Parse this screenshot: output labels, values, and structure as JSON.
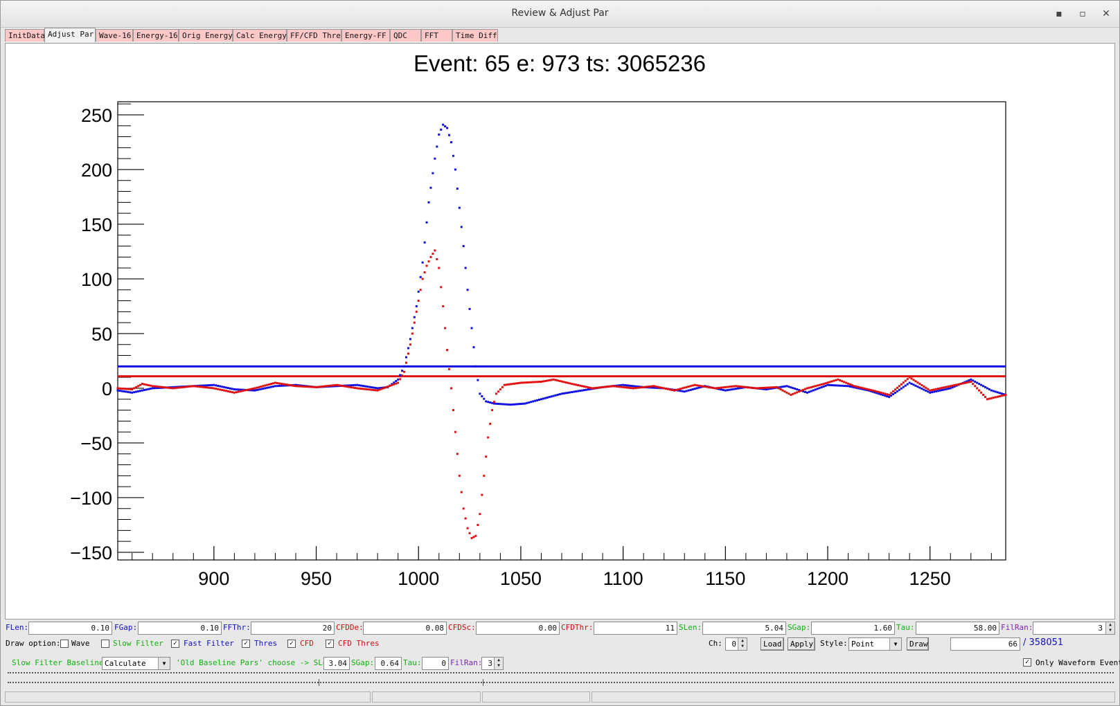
{
  "window": {
    "title": "Review & Adjust Par"
  },
  "tabs": [
    {
      "label": "InitData"
    },
    {
      "label": "Adjust Par"
    },
    {
      "label": "Wave-16"
    },
    {
      "label": "Energy-16"
    },
    {
      "label": "Orig Energy"
    },
    {
      "label": "Calc Energy"
    },
    {
      "label": "FF/CFD Thre"
    },
    {
      "label": "Energy-FF"
    },
    {
      "label": "QDC"
    },
    {
      "label": "FFT"
    },
    {
      "label": "Time Diff"
    }
  ],
  "chart_data": {
    "type": "scatter",
    "title": "Event: 65    e: 973    ts: 3065236",
    "xlabel": "",
    "ylabel": "",
    "xlim": [
      853,
      1287
    ],
    "ylim": [
      -157,
      262
    ],
    "x_ticks": [
      900,
      950,
      1000,
      1050,
      1100,
      1150,
      1200,
      1250
    ],
    "y_ticks": [
      -150,
      -100,
      -50,
      0,
      50,
      100,
      150,
      200,
      250
    ],
    "grid": false,
    "threshold_lines": [
      {
        "value": 20,
        "color": "#1010e0"
      },
      {
        "value": 11,
        "color": "#e01010"
      }
    ],
    "series": [
      {
        "color": "#1010e0",
        "points": [
          [
            853,
            -2
          ],
          [
            860,
            -4
          ],
          [
            870,
            0
          ],
          [
            880,
            1
          ],
          [
            890,
            2
          ],
          [
            900,
            3
          ],
          [
            910,
            -1
          ],
          [
            920,
            -2
          ],
          [
            930,
            2
          ],
          [
            940,
            3
          ],
          [
            950,
            1
          ],
          [
            960,
            2
          ],
          [
            970,
            3
          ],
          [
            980,
            0
          ],
          [
            985,
            1
          ],
          [
            990,
            8
          ],
          [
            993,
            20
          ],
          [
            996,
            45
          ],
          [
            999,
            75
          ],
          [
            1002,
            115
          ],
          [
            1005,
            170
          ],
          [
            1008,
            210
          ],
          [
            1010,
            232
          ],
          [
            1012,
            241
          ],
          [
            1014,
            238
          ],
          [
            1016,
            225
          ],
          [
            1018,
            200
          ],
          [
            1020,
            165
          ],
          [
            1022,
            130
          ],
          [
            1024,
            90
          ],
          [
            1026,
            55
          ],
          [
            1028,
            20
          ],
          [
            1030,
            -5
          ],
          [
            1033,
            -12
          ],
          [
            1037,
            -14
          ],
          [
            1045,
            -15
          ],
          [
            1052,
            -14
          ],
          [
            1060,
            -10
          ],
          [
            1070,
            -5
          ],
          [
            1080,
            -2
          ],
          [
            1090,
            1
          ],
          [
            1100,
            3
          ],
          [
            1110,
            1
          ],
          [
            1120,
            0
          ],
          [
            1130,
            -3
          ],
          [
            1140,
            2
          ],
          [
            1150,
            -2
          ],
          [
            1160,
            1
          ],
          [
            1170,
            -1
          ],
          [
            1180,
            2
          ],
          [
            1190,
            -4
          ],
          [
            1200,
            3
          ],
          [
            1210,
            2
          ],
          [
            1220,
            -2
          ],
          [
            1230,
            -8
          ],
          [
            1240,
            5
          ],
          [
            1250,
            -4
          ],
          [
            1260,
            0
          ],
          [
            1270,
            8
          ],
          [
            1280,
            -2
          ],
          [
            1287,
            -6
          ]
        ]
      },
      {
        "color": "#e01010",
        "points": [
          [
            853,
            0
          ],
          [
            860,
            -1
          ],
          [
            865,
            4
          ],
          [
            870,
            2
          ],
          [
            880,
            0
          ],
          [
            890,
            2
          ],
          [
            900,
            0
          ],
          [
            910,
            -4
          ],
          [
            920,
            0
          ],
          [
            930,
            5
          ],
          [
            940,
            2
          ],
          [
            950,
            1
          ],
          [
            960,
            3
          ],
          [
            970,
            0
          ],
          [
            980,
            -2
          ],
          [
            990,
            5
          ],
          [
            993,
            15
          ],
          [
            996,
            40
          ],
          [
            999,
            70
          ],
          [
            1002,
            100
          ],
          [
            1004,
            112
          ],
          [
            1006,
            120
          ],
          [
            1008,
            126
          ],
          [
            1010,
            110
          ],
          [
            1012,
            75
          ],
          [
            1014,
            35
          ],
          [
            1016,
            0
          ],
          [
            1018,
            -40
          ],
          [
            1020,
            -80
          ],
          [
            1022,
            -110
          ],
          [
            1024,
            -128
          ],
          [
            1026,
            -137
          ],
          [
            1028,
            -135
          ],
          [
            1030,
            -115
          ],
          [
            1032,
            -80
          ],
          [
            1034,
            -45
          ],
          [
            1036,
            -20
          ],
          [
            1038,
            -5
          ],
          [
            1042,
            3
          ],
          [
            1050,
            5
          ],
          [
            1060,
            6
          ],
          [
            1066,
            8
          ],
          [
            1075,
            4
          ],
          [
            1085,
            0
          ],
          [
            1095,
            2
          ],
          [
            1105,
            0
          ],
          [
            1115,
            2
          ],
          [
            1125,
            -2
          ],
          [
            1135,
            3
          ],
          [
            1145,
            0
          ],
          [
            1155,
            2
          ],
          [
            1165,
            0
          ],
          [
            1175,
            1
          ],
          [
            1182,
            -6
          ],
          [
            1190,
            0
          ],
          [
            1198,
            4
          ],
          [
            1205,
            8
          ],
          [
            1213,
            2
          ],
          [
            1222,
            -2
          ],
          [
            1230,
            -6
          ],
          [
            1240,
            10
          ],
          [
            1250,
            -2
          ],
          [
            1260,
            2
          ],
          [
            1270,
            6
          ],
          [
            1278,
            -10
          ],
          [
            1287,
            -6
          ]
        ]
      }
    ]
  },
  "params": {
    "flen": {
      "label": "FLen:",
      "value": "0.10",
      "color": "#1010c0"
    },
    "fgap": {
      "label": "FGap:",
      "value": "0.10",
      "color": "#1010c0"
    },
    "ffthr": {
      "label": "FFThr:",
      "value": "20",
      "color": "#1010c0"
    },
    "cfdde": {
      "label": "CFDDe:",
      "value": "0.08",
      "color": "#d01010"
    },
    "cfdsc": {
      "label": "CFDSc:",
      "value": "0.00",
      "color": "#d01010"
    },
    "cfdthr": {
      "label": "CFDThr:",
      "value": "11",
      "color": "#d01010"
    },
    "slen": {
      "label": "SLen:",
      "value": "5.04",
      "color": "#10b010"
    },
    "sgap": {
      "label": "SGap:",
      "value": "1.60",
      "color": "#10b010"
    },
    "tau": {
      "label": "Tau:",
      "value": "58.00",
      "color": "#10b010"
    },
    "filran": {
      "label": "FilRan:",
      "value": "3",
      "color": "#8020c0"
    }
  },
  "draw_options": {
    "label": "Draw option:",
    "wave": {
      "label": "Wave",
      "checked": false
    },
    "slow_filter": {
      "label": "Slow Filter",
      "checked": false
    },
    "fast_filter": {
      "label": "Fast Filter",
      "checked": true
    },
    "thres": {
      "label": "Thres",
      "checked": true
    },
    "cfd": {
      "label": "CFD",
      "checked": true
    },
    "cfd_thres": {
      "label": "CFD Thres",
      "checked": true
    },
    "ch_label": "Ch:",
    "ch_value": "0",
    "load": "Load",
    "apply": "Apply",
    "style_label": "Style:",
    "style_value": "Point",
    "draw": "Draw",
    "event_value": "66",
    "event_total": "/ 358051"
  },
  "baseline": {
    "label": "Slow Filter Baseline:",
    "mode": "Calculate",
    "old_label": "'Old Baseline Pars' choose -> SLen:",
    "slen": "3.04",
    "sgap_label": "SGap:",
    "sgap": "0.64",
    "tau_label": "Tau:",
    "tau": "0",
    "filran_label": "FilRan:",
    "filran": "3",
    "only_wave": {
      "label": "Only Waveform Event",
      "checked": true
    }
  },
  "glyphs": {
    "check": "✓",
    "minimize": "▪",
    "maximize": "▫",
    "close": "✕",
    "down": "▼",
    "up_small": "▲",
    "down_small": "▼"
  }
}
